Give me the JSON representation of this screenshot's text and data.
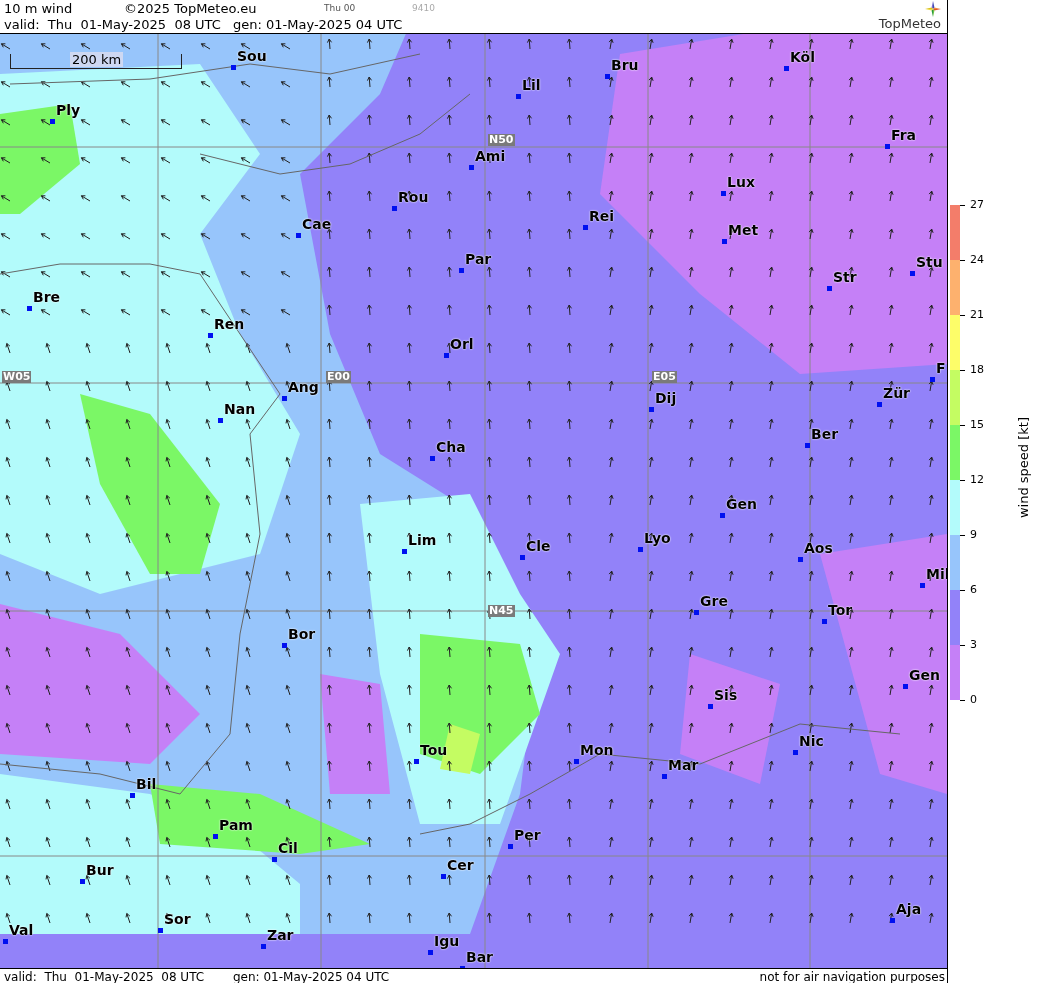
{
  "header": {
    "title": "10 m wind",
    "copyright": "©2025 TopMeteo.eu",
    "run_label": "Thu 00",
    "code": "9410",
    "valid": "valid:  Thu  01-May-2025  08 UTC",
    "generated": "gen: 01-May-2025 04 UTC",
    "logo": "TopMeteo"
  },
  "map": {
    "scale_label": "200 km",
    "grid_labels": [
      "N50",
      "W05",
      "E00",
      "E05",
      "N45"
    ],
    "cities": [
      "Sou",
      "Bru",
      "Köl",
      "Lil",
      "Ply",
      "Fra",
      "Ami",
      "Lux",
      "Rou",
      "Rei",
      "Cae",
      "Met",
      "Par",
      "Stu",
      "Str",
      "Bre",
      "Ren",
      "Orl",
      "F",
      "Ang",
      "Nan",
      "Dij",
      "Zür",
      "Ber",
      "Cha",
      "Gen",
      "Lim",
      "Cle",
      "Lyo",
      "Aos",
      "Mil",
      "Gre",
      "Tor",
      "Bor",
      "Gen",
      "Sis",
      "Nic",
      "Tou",
      "Mon",
      "Mar",
      "Bil",
      "Pam",
      "Cil",
      "Per",
      "Bur",
      "Cer",
      "Aja",
      "Sor",
      "Val",
      "Zar",
      "Igu",
      "Bar"
    ]
  },
  "legend": {
    "title": "wind speed [kt]",
    "ticks": [
      "27",
      "24",
      "21",
      "18",
      "15",
      "12",
      "9",
      "6",
      "3",
      "0"
    ],
    "bins": [
      {
        "color": "#f37d6a"
      },
      {
        "color": "#fdb16e"
      },
      {
        "color": "#fdfd69"
      },
      {
        "color": "#c4fc62"
      },
      {
        "color": "#7bf766"
      },
      {
        "color": "#b3fbfb"
      },
      {
        "color": "#97c5fb"
      },
      {
        "color": "#9282f9"
      },
      {
        "color": "#c580f7"
      }
    ]
  },
  "footer": {
    "valid": "valid:  Thu  01-May-2025  08 UTC",
    "generated": "gen: 01-May-2025 04 UTC",
    "disclaimer": "not for air navigation purposes"
  }
}
